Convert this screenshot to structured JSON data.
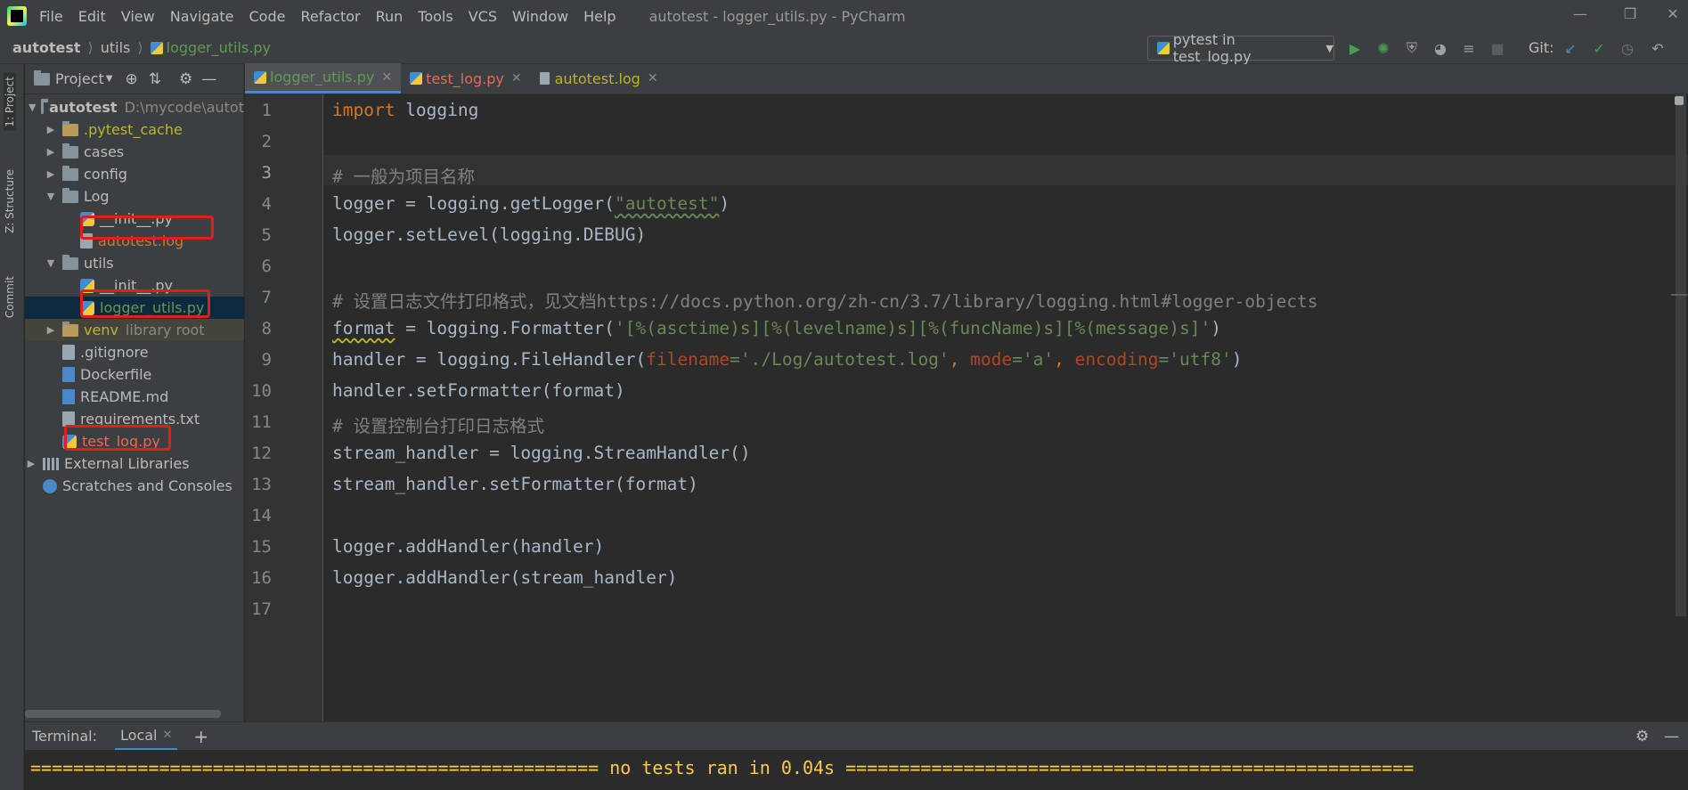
{
  "menu": [
    "File",
    "Edit",
    "View",
    "Navigate",
    "Code",
    "Refactor",
    "Run",
    "Tools",
    "VCS",
    "Window",
    "Help"
  ],
  "window_title": "autotest - logger_utils.py - PyCharm",
  "breadcrumb": [
    "autotest",
    "utils",
    "logger_utils.py"
  ],
  "run_config": "pytest in test_log.py",
  "git_label": "Git:",
  "left_strip_tabs": [
    "1: Project",
    "Z: Structure",
    "Commit"
  ],
  "project": {
    "header": "Project",
    "root_name": "autotest",
    "root_path": "D:\\mycode\\autot",
    "items": [
      {
        "label": ".pytest_cache"
      },
      {
        "label": "cases"
      },
      {
        "label": "config"
      },
      {
        "label": "Log"
      },
      {
        "label": "__init__.py"
      },
      {
        "label": "autotest.log"
      },
      {
        "label": "utils"
      },
      {
        "label": "__init__.py"
      },
      {
        "label": "logger_utils.py"
      },
      {
        "label": "venv",
        "hint": "library root"
      },
      {
        "label": ".gitignore"
      },
      {
        "label": "Dockerfile"
      },
      {
        "label": "README.md"
      },
      {
        "label": "requirements.txt"
      },
      {
        "label": "test_log.py"
      },
      {
        "label": "External Libraries"
      },
      {
        "label": "Scratches and Consoles"
      }
    ]
  },
  "tabs": [
    {
      "label": "logger_utils.py",
      "color": "#629755"
    },
    {
      "label": "test_log.py",
      "color": "#e06b5a"
    },
    {
      "label": "autotest.log",
      "color": "#bbb529"
    }
  ],
  "code": {
    "line_numbers": [
      "1",
      "2",
      "3",
      "4",
      "5",
      "6",
      "7",
      "8",
      "9",
      "10",
      "11",
      "12",
      "13",
      "14",
      "15",
      "16",
      "17"
    ],
    "l1_kw": "import",
    "l1_rest": " logging",
    "l3": "# 一般为项目名称",
    "l4_a": "logger = logging.getLogger(",
    "l4_str": "\"autotest\"",
    "l4_b": ")",
    "l5": "logger.setLevel(logging.DEBUG)",
    "l7": "# 设置日志文件打印格式，见文档https://docs.python.org/zh-cn/3.7/library/logging.html#logger-objects",
    "l8_a": "format",
    "l8_b": " = logging.Formatter(",
    "l8_str": "'[%(asctime)s][%(levelname)s][%(funcName)s][%(message)s]'",
    "l8_c": ")",
    "l9_a": "handler = logging.FileHandler(",
    "l9_p1": "filename",
    "l9_s1": "='./Log/autotest.log'",
    "l9_c1": ", ",
    "l9_p2": "mode",
    "l9_s2": "='a'",
    "l9_c2": ", ",
    "l9_p3": "encoding",
    "l9_s3": "='utf8'",
    "l9_c3": ")",
    "l10": "handler.setFormatter(format)",
    "l11": "# 设置控制台打印日志格式",
    "l12": "stream_handler = logging.StreamHandler()",
    "l13": "stream_handler.setFormatter(format)",
    "l15": "logger.addHandler(handler)",
    "l16": "logger.addHandler(stream_handler)"
  },
  "terminal": {
    "label": "Terminal:",
    "tab": "Local",
    "add": "+",
    "output": "===================================================== no tests ran in 0.04s ====================================================="
  }
}
